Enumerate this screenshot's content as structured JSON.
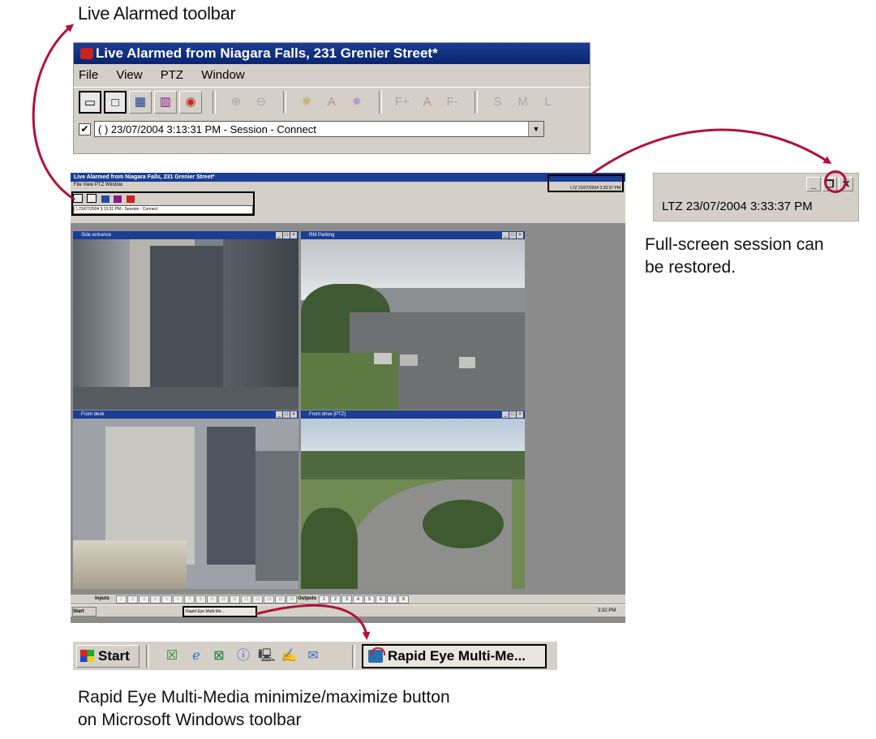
{
  "captions": {
    "toolbar": "Live Alarmed toolbar",
    "restore_line1": "Full-screen session can",
    "restore_line2": "be restored.",
    "taskbar_line1": "Rapid Eye Multi-Media minimize/maximize button",
    "taskbar_line2": "on Microsoft Windows toolbar"
  },
  "window": {
    "title": "Live Alarmed from Niagara Falls, 231 Grenier Street*",
    "menu": [
      "File",
      "View",
      "PTZ",
      "Window"
    ],
    "session_entry": "( ) 23/07/2004 3:13:31 PM - Session - Connect",
    "session_checked": true,
    "view_buttons": [
      "single-view",
      "quad-view",
      "grid-view",
      "film-view",
      "alarm-view"
    ],
    "tool_labels": [
      "F+",
      "A",
      "F-",
      "S",
      "M",
      "L"
    ]
  },
  "restore_box": {
    "buttons": [
      "_",
      "❐",
      "✕"
    ],
    "timestamp": "LTZ 23/07/2004 3:33:37 PM"
  },
  "screen": {
    "title": "Live Alarmed from Niagara Falls, 231 Grenier Street*",
    "menu": "File  View  PTZ  Window",
    "session_entry": "( ) 23/07/2004 3:13:31 PM - Session - Connect",
    "timestamp": "LTZ 23/07/2004 3:33:37 PM",
    "panes": [
      {
        "title": "Side entrance"
      },
      {
        "title": "RM Parking"
      },
      {
        "title": "Front desk"
      },
      {
        "title": "Front drive [PTZ]"
      }
    ],
    "inputs_label": "Inputs",
    "inputs": [
      "1",
      "2",
      "3",
      "4",
      "5",
      "6",
      "7",
      "8",
      "9",
      "10",
      "11",
      "12",
      "13",
      "14",
      "15",
      "16"
    ],
    "outputs_label": "Outputs",
    "outputs": [
      "1",
      "2",
      "3",
      "4",
      "5",
      "6",
      "7",
      "8"
    ],
    "taskbar_button": "Rapid Eye Multi-Me...",
    "clock": "3:32 PM"
  },
  "taskbar": {
    "start_label": "Start",
    "quick_launch": [
      "outlook-icon",
      "ie-icon",
      "excel-icon",
      "info-icon",
      "network-icon",
      "notepad-icon",
      "mail-icon"
    ],
    "task_button": "Rapid Eye Multi-Me..."
  },
  "colors": {
    "title_bar": "#1b3e94",
    "arrow": "#b0123a",
    "highlight_ring": "#b0123a"
  }
}
